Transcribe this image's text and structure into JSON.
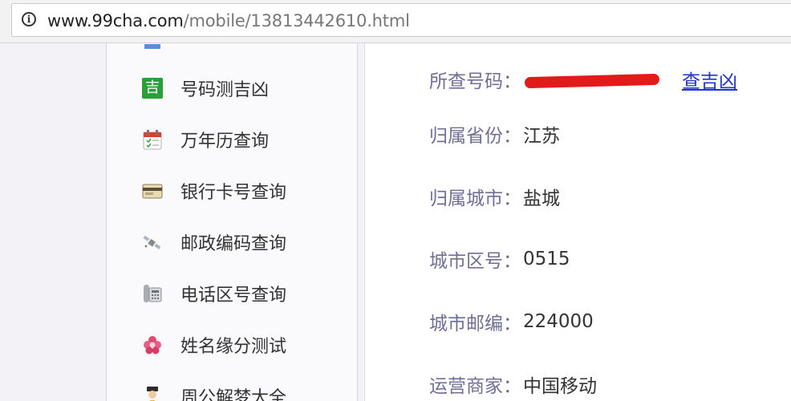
{
  "browser": {
    "url_host": "www.99cha.com",
    "url_path": "/mobile/13813442610.html"
  },
  "sidebar": {
    "items": [
      {
        "label": "号码测吉凶",
        "icon": "ji-icon"
      },
      {
        "label": "万年历查询",
        "icon": "calendar-icon"
      },
      {
        "label": "银行卡号查询",
        "icon": "bank-card-icon"
      },
      {
        "label": "邮政编码查询",
        "icon": "satellite-icon"
      },
      {
        "label": "电话区号查询",
        "icon": "telephone-icon"
      },
      {
        "label": "姓名缘分测试",
        "icon": "flower-icon"
      },
      {
        "label": "周公解梦大全",
        "icon": "figure-icon"
      }
    ],
    "ji_glyph": "吉"
  },
  "main": {
    "rows": [
      {
        "key": "所查号码：",
        "value": ""
      },
      {
        "key": "归属省份：",
        "value": "江苏"
      },
      {
        "key": "归属城市：",
        "value": "盐城"
      },
      {
        "key": "城市区号：",
        "value": "0515"
      },
      {
        "key": "城市邮编：",
        "value": "224000"
      },
      {
        "key": "运营商家：",
        "value": "中国移动"
      }
    ],
    "lookup_link": "查吉凶",
    "redaction_color": "#e31a1a"
  }
}
